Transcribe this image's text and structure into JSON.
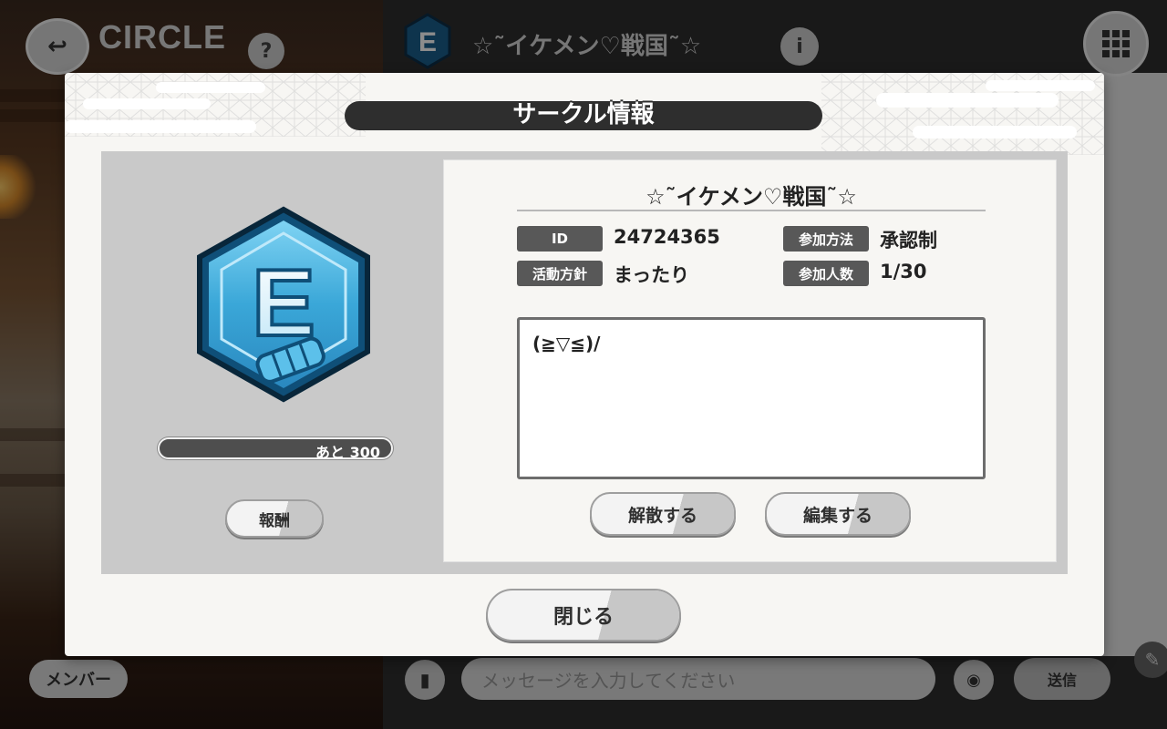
{
  "app": {
    "screen_title": "CIRCLE",
    "help_icon": "?",
    "circle_name": "☆˜イケメン♡戦国˜☆",
    "info_icon": "i",
    "grid_icon": "grid-icon"
  },
  "bottom_bar": {
    "member_label": "メンバー",
    "message_placeholder": "メッセージを入力してください",
    "send_label": "送信"
  },
  "modal": {
    "title": "サークル情報",
    "emblem_letter": "E",
    "exp_label": "あと 300",
    "exp_progress": 0.0,
    "reward_button": "報酬",
    "circle_name": "☆˜イケメン♡戦国˜☆",
    "fields": {
      "id_label": "ID",
      "id_value": "24724365",
      "join_method_label": "参加方法",
      "join_method_value": "承認制",
      "policy_label": "活動方針",
      "policy_value": "まったり",
      "members_label": "参加人数",
      "members_value": "1/30"
    },
    "description": "(≧▽≦)/",
    "disband_button": "解散する",
    "edit_button": "編集する",
    "close_button": "閉じる"
  },
  "colors": {
    "emblem_blue": "#3aa7d8",
    "emblem_dark": "#0f4f78",
    "tag_gray": "#585858",
    "title_bar": "#2e2e2e"
  }
}
